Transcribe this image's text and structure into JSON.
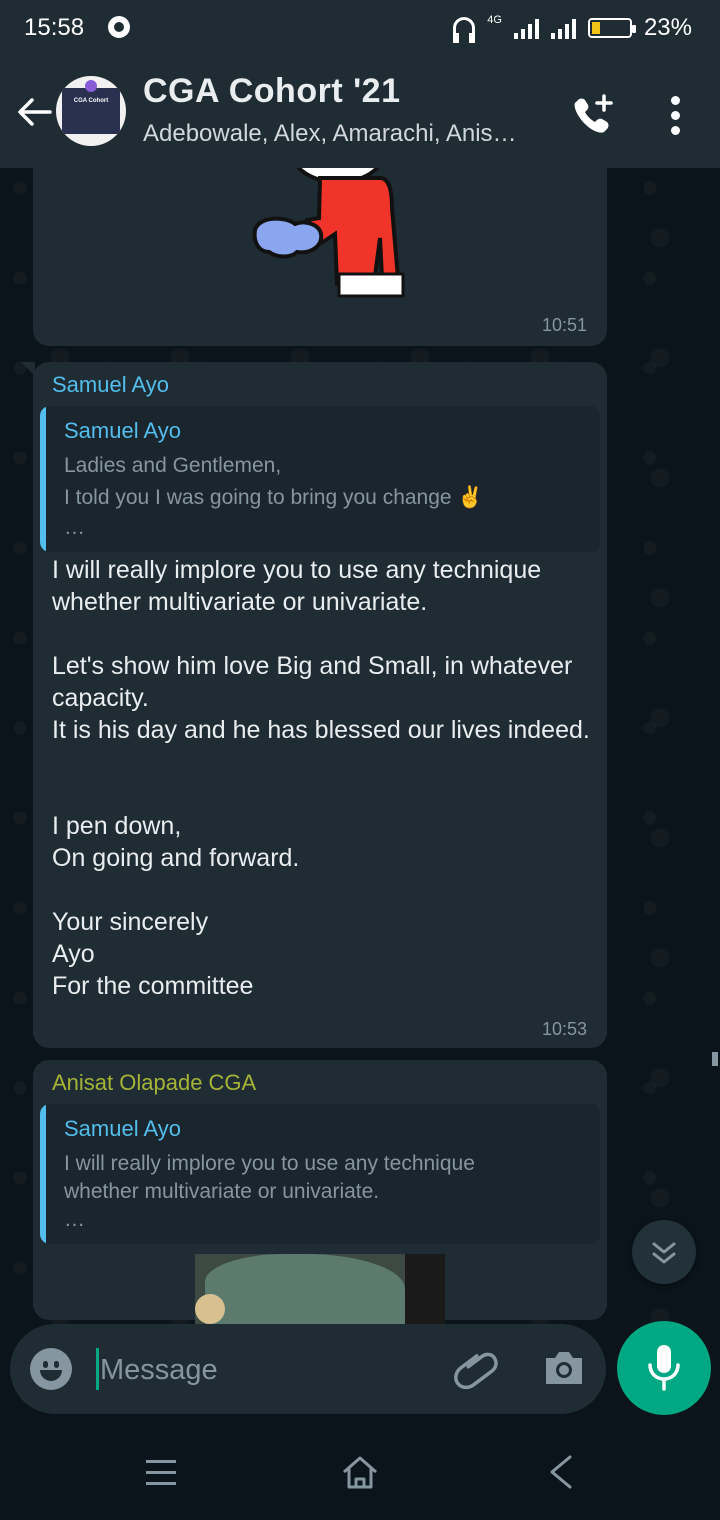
{
  "status_bar": {
    "time": "15:58",
    "network": "4G",
    "battery_percent": "23%",
    "battery_level": 0.23
  },
  "header": {
    "title": "CGA Cohort '21",
    "subtitle": "Adebowale, Alex, Amarachi, Anis…",
    "avatar_text": "CGA Cohort"
  },
  "messages": [
    {
      "type": "sticker",
      "time": "10:51"
    },
    {
      "sender": "Samuel Ayo",
      "sender_color": "#53bdeb",
      "quote": {
        "name": "Samuel Ayo",
        "line1": "Ladies and Gentlemen,",
        "line2": "I told you I was going to bring you change ✌️",
        "line3": "…"
      },
      "text": "I will really implore you to use any technique whether multivariate or univariate.\n\nLet's show him love Big and Small, in whatever capacity.\nIt is his day and he has blessed our lives indeed.\n\n\nI pen down,\nOn going and forward.\n\nYour sincerely\nAyo\nFor the committee",
      "time": "10:53"
    },
    {
      "sender": "Anisat Olapade CGA",
      "sender_color": "#a5b337",
      "quote": {
        "name": "Samuel Ayo",
        "line1": "I will really implore you to use any technique",
        "line2": "whether multivariate or univariate.",
        "line3": "…"
      }
    }
  ],
  "composer": {
    "placeholder": "Message"
  },
  "colors": {
    "accent": "#00a884",
    "header_bg": "#1f2c34",
    "chat_bg": "#0b141a",
    "bubble_bg": "#1f2c34"
  },
  "icons": [
    "back-arrow-icon",
    "add-call-icon",
    "more-vert-icon",
    "emoji-icon",
    "attach-icon",
    "camera-icon",
    "mic-icon",
    "scroll-down-icon",
    "nav-menu-icon",
    "nav-home-icon",
    "nav-back-icon"
  ]
}
